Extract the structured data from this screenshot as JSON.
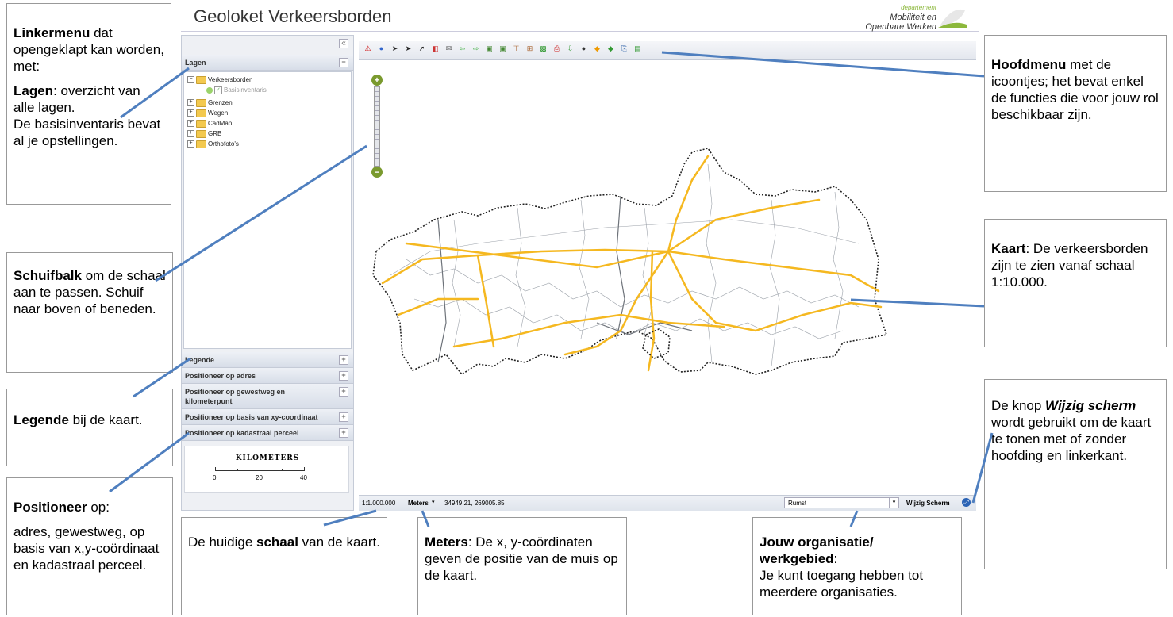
{
  "app": {
    "title": "Geoloket Verkeersborden",
    "logo_small": "departement",
    "logo_line1": "Mobiliteit en",
    "logo_line2": "Openbare Werken"
  },
  "left_panel": {
    "collapse_symbol": "«",
    "layers_header": "Lagen",
    "tree": [
      {
        "label": "Verkeersborden"
      },
      {
        "label": "Basisinventaris"
      },
      {
        "label": "Grenzen"
      },
      {
        "label": "Wegen"
      },
      {
        "label": "CadMap"
      },
      {
        "label": "GRB"
      },
      {
        "label": "Orthofoto's"
      }
    ],
    "sections": [
      "Legende",
      "Positioneer op adres",
      "Positioneer op gewestweg en kilometerpunt",
      "Positioneer op basis van xy-coordinaat",
      "Positioneer op kadastraal perceel"
    ],
    "scale_title": "KILOMETERS",
    "scale_ticks": [
      "0",
      "20",
      "40"
    ]
  },
  "status": {
    "scale": "1:1.000.000",
    "units": "Meters",
    "coords": "34949.21, 269005.85",
    "organisation": "Rumst",
    "change_screen": "Wijzig Scherm"
  },
  "callouts": {
    "left_menu": {
      "b1": "Linkermenu",
      "t1": " dat opengeklapt kan worden, met:",
      "b2": "Lagen",
      "t2": ": overzicht van alle lagen.",
      "t3": "De basisinventaris bevat al je opstellingen."
    },
    "slider": {
      "b1": "Schuifbalk",
      "t1": " om de schaal aan te passen. Schuif naar boven of beneden."
    },
    "legend": {
      "b1": "Legende",
      "t1": " bij de kaart."
    },
    "position": {
      "b1": "Positioneer",
      "t1": " op:",
      "t2": "adres, gewestweg, op basis van x,y-coördinaat en kadastraal perceel."
    },
    "scale": {
      "t1": "De huidige ",
      "b1": "schaal",
      "t2": " van de kaart."
    },
    "meters": {
      "b1": "Meters",
      "t1": ": De x, y-coördinaten geven de positie van de muis op de kaart."
    },
    "org": {
      "b1": "Jouw organisatie/ werkgebied",
      "t1": ":",
      "t2": "Je kunt toegang hebben tot meerdere organisaties."
    },
    "main_menu": {
      "b1": "Hoofdmenu",
      "t1": " met de icoontjes; het bevat enkel de functies die voor jouw rol beschikbaar zijn."
    },
    "map": {
      "b1": "Kaart",
      "t1": ": De verkeersborden zijn te zien vanaf schaal 1:10.000."
    },
    "change_screen": {
      "t1": "De knop ",
      "b1": "Wijzig scherm",
      "t2": " wordt gebruikt om de kaart te tonen met of zonder hoofding en linkerkant."
    }
  },
  "colors": {
    "accent_line": "#4f7fbf",
    "roads": "#f5b820",
    "panel": "#eef0f4"
  }
}
